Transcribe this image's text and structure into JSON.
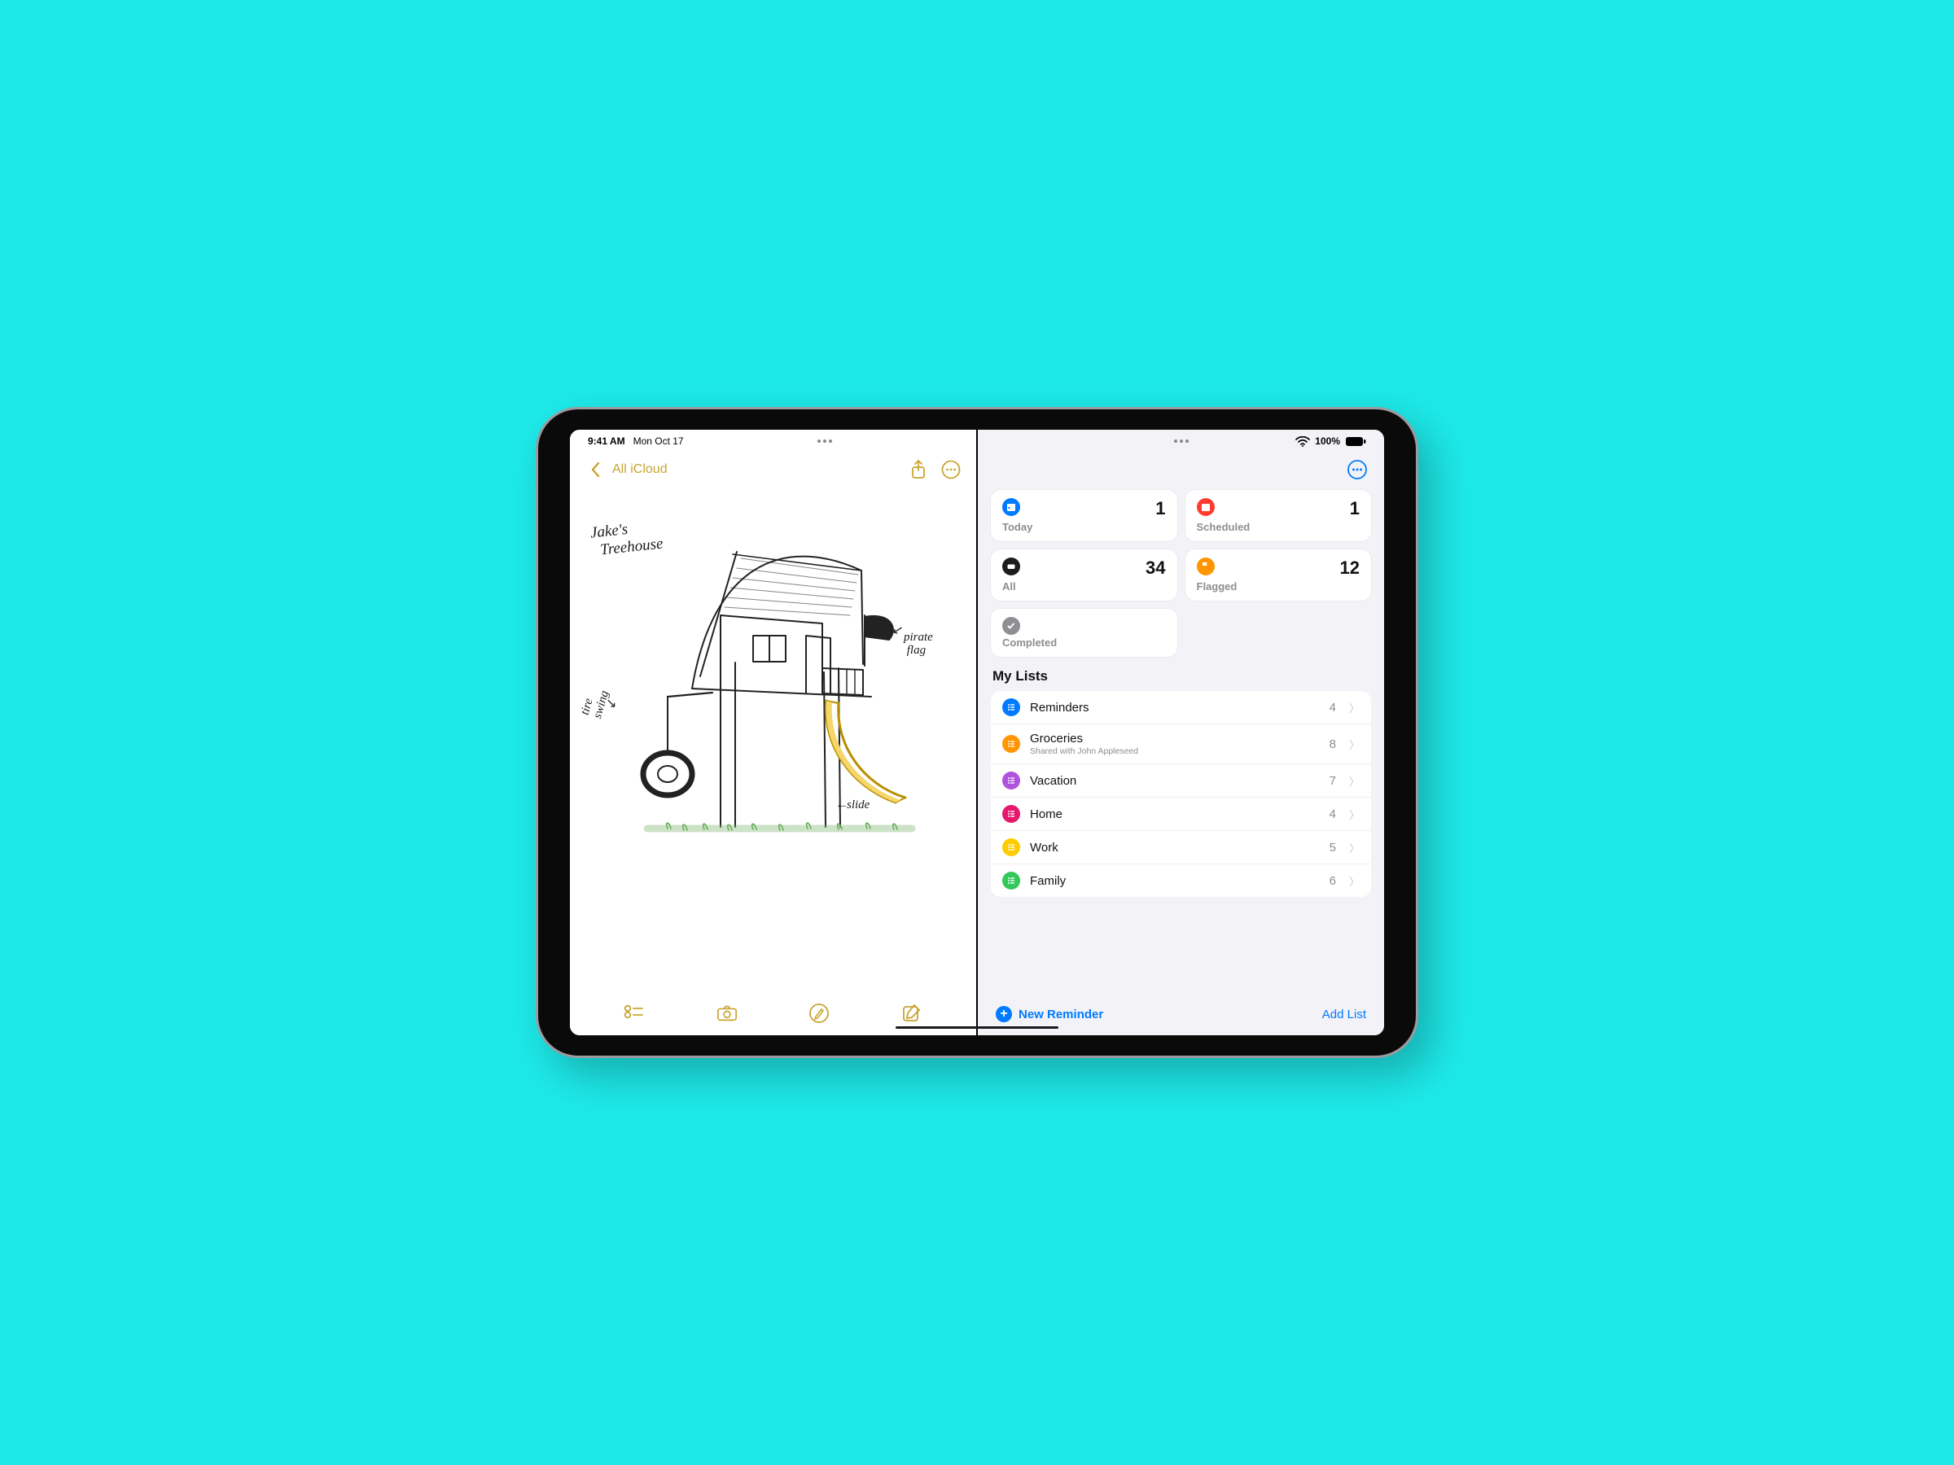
{
  "statusbar": {
    "time": "9:41 AM",
    "date": "Mon Oct 17",
    "battery": "100%"
  },
  "notes": {
    "back_label": "All iCloud",
    "sketch": {
      "title_line1": "Jake's",
      "title_line2": "Treehouse",
      "label_tire1": "tire",
      "label_tire2": "swing",
      "label_slide": "slide",
      "label_flag1": "pirate",
      "label_flag2": "flag"
    }
  },
  "reminders": {
    "cards": {
      "today": {
        "label": "Today",
        "count": "1"
      },
      "scheduled": {
        "label": "Scheduled",
        "count": "1"
      },
      "all": {
        "label": "All",
        "count": "34"
      },
      "flagged": {
        "label": "Flagged",
        "count": "12"
      },
      "completed": {
        "label": "Completed"
      }
    },
    "section": "My Lists",
    "lists": [
      {
        "name": "Reminders",
        "count": "4",
        "color": "b-blue"
      },
      {
        "name": "Groceries",
        "sub": "Shared with John Appleseed",
        "count": "8",
        "color": "b-orange"
      },
      {
        "name": "Vacation",
        "count": "7",
        "color": "b-purple"
      },
      {
        "name": "Home",
        "count": "4",
        "color": "b-pink"
      },
      {
        "name": "Work",
        "count": "5",
        "color": "b-yellow"
      },
      {
        "name": "Family",
        "count": "6",
        "color": "b-green"
      }
    ],
    "footer": {
      "new": "New Reminder",
      "add": "Add List"
    }
  }
}
